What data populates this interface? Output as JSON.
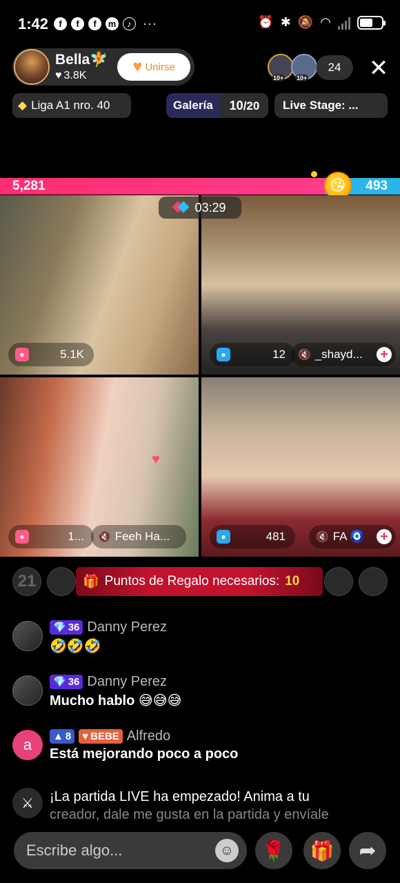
{
  "status_bar": {
    "time": "1:42",
    "app_icons": [
      "f",
      "f",
      "f",
      "m",
      "♪"
    ],
    "more": "···"
  },
  "host": {
    "name": "Bella🧚",
    "likes": "3.8K",
    "join_label": "Unirse"
  },
  "viewers": {
    "badges": [
      "10+",
      "10+"
    ],
    "count": "24"
  },
  "chips": {
    "league": "Liga A1 nro. 40",
    "gallery_label": "Galería",
    "gallery_current": "10",
    "gallery_total": "/20",
    "stage": "Live Stage: ..."
  },
  "battle": {
    "left_score": "5,281",
    "right_score": "493",
    "left_share": 0.915,
    "timer": "03:29",
    "face": "😘"
  },
  "tiles": [
    {
      "score": "5.1K",
      "color": "pink"
    },
    {
      "score": "12",
      "color": "blue",
      "name": "_shayd..."
    },
    {
      "score": "1...",
      "color": "pink",
      "name": "Feeh Ha..."
    },
    {
      "score": "481",
      "color": "blue",
      "name": "FA 🧿"
    }
  ],
  "gift_bar": {
    "text": "Puntos de Regalo necesarios:",
    "number": "10",
    "left_slot_1": "21",
    "left_slot_2": "",
    "right_slot_1": "",
    "right_slot_2": ""
  },
  "comments": [
    {
      "level": "36",
      "user": "Danny Perez",
      "text": "🤣🤣🤣"
    },
    {
      "level": "36",
      "user": "Danny Perez",
      "text": "Mucho hablo 😅😅😅"
    },
    {
      "level": "8",
      "fan_badge": "BEBE",
      "user": "Alfredo",
      "avatar_letter": "a",
      "text": "Está mejorando poco a poco"
    }
  ],
  "system_message": {
    "line1": "¡La partida LIVE ha empezado! Anima a tu",
    "line2": "creador, dale me gusta en la partida y envíale"
  },
  "input": {
    "placeholder": "Escribe algo..."
  },
  "colors": {
    "left_team": "#ff2d72",
    "right_team": "#2bb5e8",
    "gift_bar": "#c2122e"
  }
}
